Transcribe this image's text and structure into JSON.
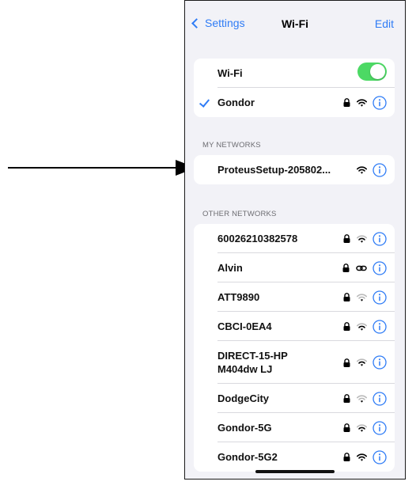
{
  "nav": {
    "back_label": "Settings",
    "title": "Wi-Fi",
    "edit_label": "Edit"
  },
  "wifi": {
    "toggle_label": "Wi-Fi",
    "toggle_on": true,
    "connected_network": "Gondor"
  },
  "my_networks": {
    "header": "MY NETWORKS",
    "items": [
      {
        "name": "ProteusSetup-205802..."
      }
    ]
  },
  "other_networks": {
    "header": "OTHER NETWORKS",
    "items": [
      {
        "name": "60026210382578",
        "icon": "wifi-icon"
      },
      {
        "name": "Alvin",
        "icon": "link-icon"
      },
      {
        "name": "ATT9890",
        "icon": "wifi-icon"
      },
      {
        "name": "CBCI-0EA4",
        "icon": "wifi-icon"
      },
      {
        "name": "DIRECT-15-HP",
        "name_line2": "M404dw LJ",
        "icon": "wifi-icon"
      },
      {
        "name": "DodgeCity",
        "icon": "wifi-icon"
      },
      {
        "name": "Gondor-5G",
        "icon": "wifi-icon"
      },
      {
        "name": "Gondor-5G2",
        "icon": "wifi-icon"
      }
    ]
  },
  "colors": {
    "accent": "#2f7cf6",
    "toggle_on": "#4cd964",
    "background": "#f2f2f7"
  }
}
